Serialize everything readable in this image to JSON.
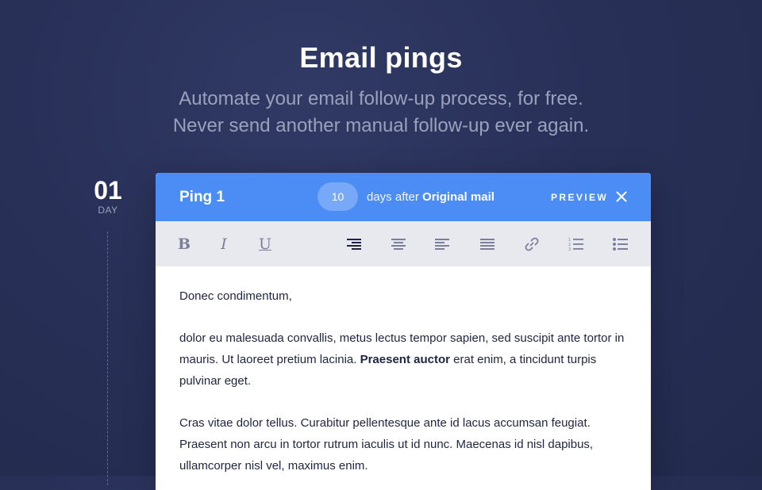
{
  "hero": {
    "title": "Email pings",
    "subtitle_line1": "Automate your email follow-up process, for free.",
    "subtitle_line2": "Never send another manual follow-up ever again."
  },
  "timeline": {
    "day_number": "01",
    "day_label": "DAY"
  },
  "ping": {
    "title": "Ping 1",
    "days_value": "10",
    "days_after_text": "days after",
    "reference": "Original mail",
    "preview_label": "PREVIEW"
  },
  "toolbar": {
    "tools": [
      "bold",
      "italic",
      "underline",
      "align-right",
      "align-center",
      "align-left",
      "align-justify",
      "link",
      "numbered-list",
      "bulleted-list"
    ],
    "active_tool": "align-right",
    "bold_glyph": "B",
    "italic_glyph": "I",
    "underline_glyph": "U"
  },
  "editor": {
    "greeting": "Donec condimentum,",
    "paragraph1_before": "dolor eu malesuada convallis, metus lectus tempor sapien, sed suscipit ante tortor in mauris. Ut laoreet pretium lacinia.",
    "paragraph1_bold": "Praesent auctor",
    "paragraph1_after": "erat enim, a tincidunt turpis pulvinar eget.",
    "paragraph2": "Cras vitae dolor tellus. Curabitur pellentesque ante id lacus accumsan feugiat. Praesent non arcu in tortor rutrum iaculis ut id nunc. Maecenas id nisl dapibus, ullamcorper nisl vel, maximus enim."
  },
  "colors": {
    "background": "#283058",
    "header_blue": "#4b8cf5",
    "chip_blue": "#78a9f9",
    "toolbar_bg": "#e7e9ef",
    "icon_gray": "#7b7f9a",
    "icon_active": "#1f2540",
    "body_text": "#1f2540",
    "muted_text": "#9aa1bd"
  }
}
